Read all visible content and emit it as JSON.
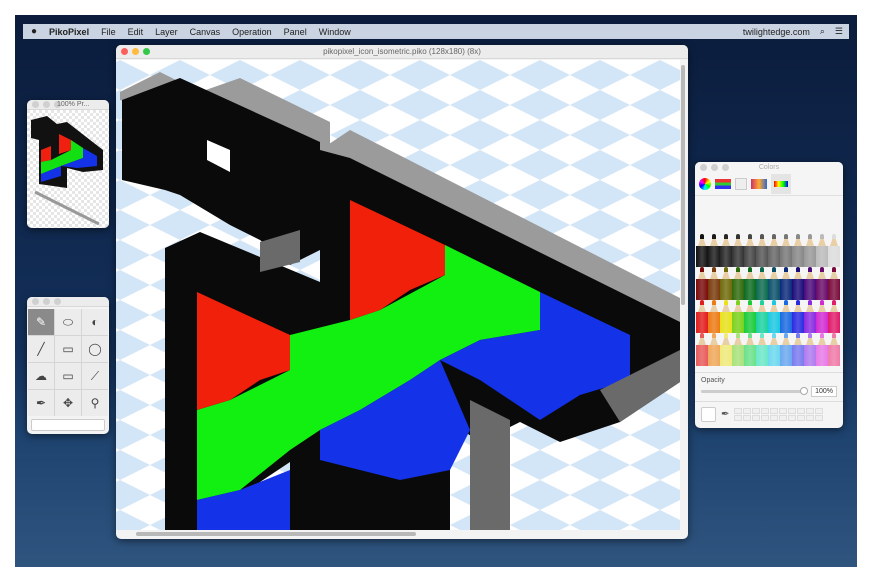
{
  "menubar": {
    "apple": "",
    "app": "PikoPixel",
    "items": [
      "File",
      "Edit",
      "Layer",
      "Canvas",
      "Operation",
      "Panel",
      "Window"
    ],
    "right_text": "twilightedge.com",
    "search_icon": "⌕",
    "list_icon": "☰"
  },
  "main_window": {
    "title": "pikopixel_icon_isometric.piko (128x180) (8x)"
  },
  "preview_window": {
    "title": "100% Pr..."
  },
  "tools": [
    "pencil",
    "eraser",
    "fill-bucket",
    "line",
    "rectangle",
    "ellipse",
    "freeform-select",
    "rect-select",
    "magic-wand",
    "eyedropper",
    "move",
    "zoom"
  ],
  "tool_glyphs": [
    "✎",
    "⬭",
    "◐",
    "╱",
    "▭",
    "◯",
    "☁",
    "▭",
    "⟋",
    "✒",
    "✥",
    "⚲"
  ],
  "colors_window": {
    "title": "Colors",
    "opacity_label": "Opacity",
    "opacity_value": "100%",
    "opacity": 1.0
  },
  "pencil_colors": [
    [
      "#111111",
      "#1a1a1a",
      "#262626",
      "#333333",
      "#444444",
      "#555555",
      "#666666",
      "#777777",
      "#888888",
      "#999999",
      "#bbbbbb",
      "#dddddd"
    ],
    [
      "#7a0a0a",
      "#7a3a0a",
      "#6f6a0a",
      "#2f6a0a",
      "#0a6a1f",
      "#0a6a4f",
      "#0a4f6a",
      "#0a2a7a",
      "#1a0a7a",
      "#4a0a7a",
      "#6a0a6a",
      "#7a0a3a"
    ],
    [
      "#e21c1c",
      "#ee7a12",
      "#e9e11a",
      "#7ad21a",
      "#1acb3a",
      "#1ad2a0",
      "#1ac8e2",
      "#1a6ae2",
      "#2a2ae2",
      "#8a2ae2",
      "#d22ad2",
      "#e21a6a"
    ],
    [
      "#e85a5a",
      "#f0a85a",
      "#f0ea7a",
      "#a8e27a",
      "#6ae28a",
      "#6ae8c8",
      "#6ad8f0",
      "#6aa8f0",
      "#7a7af0",
      "#b07af0",
      "#e87ae8",
      "#f07aa8"
    ]
  ]
}
